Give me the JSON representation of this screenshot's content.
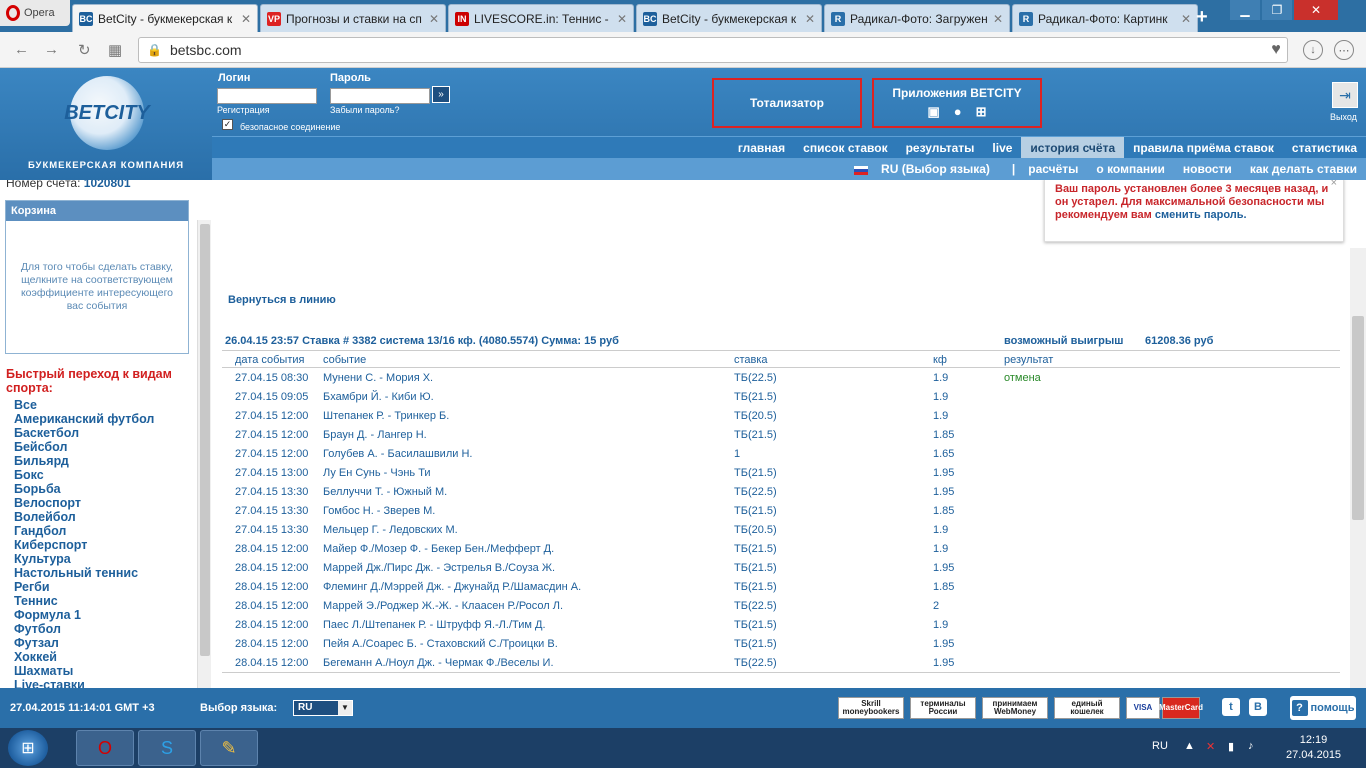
{
  "browser": {
    "menu_label": "Opera",
    "tabs": [
      {
        "title": "BetCity - букмекерская к",
        "icon": "BC",
        "color": "#1d5f9b"
      },
      {
        "title": "Прогнозы и ставки на сп",
        "icon": "VP",
        "color": "#d22"
      },
      {
        "title": "LIVESCORE.in: Теннис - А",
        "icon": "IN",
        "color": "#c00"
      },
      {
        "title": "BetCity - букмекерская к",
        "icon": "BC",
        "color": "#1d5f9b"
      },
      {
        "title": "Радикал-Фото: Загружен",
        "icon": "R",
        "color": "#2a6fa9"
      },
      {
        "title": "Радикал-Фото: Картинк",
        "icon": "R",
        "color": "#2a6fa9"
      }
    ],
    "url": "betsbc.com"
  },
  "header": {
    "logo_text": "BETCITY",
    "logo_sub": "БУКМЕКЕРСКАЯ КОМПАНИЯ",
    "login_label": "Логин",
    "password_label": "Пароль",
    "register_link": "Регистрация",
    "forgot_link": "Забыли пароль?",
    "secure_label": "безопасное соединение",
    "totalizator": "Тотализатор",
    "apps": "Приложения BETCITY",
    "exit": "Выход"
  },
  "menu_main": [
    "главная",
    "список ставок",
    "результаты",
    "live",
    "история счёта",
    "правила приёма ставок",
    "статистика"
  ],
  "menu_sub": {
    "lang": "RU (Выбор языка)",
    "items": [
      "расчёты",
      "о компании",
      "новости",
      "как делать ставки"
    ]
  },
  "left": {
    "account_label": "Номер счёта:",
    "account_number": "1020801",
    "basket_title": "Корзина",
    "basket_text": "Для того чтобы сделать ставку, щелкните на соответствующем коэффициенте интересующего вас события",
    "quick_title": "Быстрый переход к видам спорта:",
    "sports": [
      "Все",
      "Американский футбол",
      "Баскетбол",
      "Бейсбол",
      "Бильярд",
      "Бокс",
      "Борьба",
      "Велоспорт",
      "Волейбол",
      "Гандбол",
      "Киберспорт",
      "Культура",
      "Настольный теннис",
      "Регби",
      "Теннис",
      "Формула 1",
      "Футбол",
      "Футзал",
      "Хоккей",
      "Шахматы",
      "Live-ставки"
    ]
  },
  "notice": {
    "text": "Ваш пароль установлен более 3 месяцев назад, и он устарел. Для максимальной безопасности мы рекомендуем вам",
    "link": "сменить пароль.",
    "close": "×"
  },
  "bet": {
    "back_link": "Вернуться в линию",
    "summary": "26.04.15 23:57  Ставка # 3382  система 13/16 кф. (4080.5574)  Сумма: 15 руб",
    "win_label": "возможный выигрыш",
    "win_value": "61208.36 руб",
    "columns": [
      "дата события",
      "событие",
      "ставка",
      "кф",
      "результат"
    ],
    "rows": [
      [
        "27.04.15 08:30",
        "Мунени С. - Мория Х.",
        "ТБ(22.5)",
        "1.9",
        "отмена"
      ],
      [
        "27.04.15 09:05",
        "Бхамбри Й. - Киби Ю.",
        "ТБ(21.5)",
        "1.9",
        ""
      ],
      [
        "27.04.15 12:00",
        "Штепанек Р. - Тринкер Б.",
        "ТБ(20.5)",
        "1.9",
        ""
      ],
      [
        "27.04.15 12:00",
        "Браун Д. - Лангер Н.",
        "ТБ(21.5)",
        "1.85",
        ""
      ],
      [
        "27.04.15 12:00",
        "Голубев А. - Басилашвили Н.",
        "1",
        "1.65",
        ""
      ],
      [
        "27.04.15 13:00",
        "Лу Ен Сунь - Чэнь Ти",
        "ТБ(21.5)",
        "1.95",
        ""
      ],
      [
        "27.04.15 13:30",
        "Беллуччи Т. - Южный М.",
        "ТБ(22.5)",
        "1.95",
        ""
      ],
      [
        "27.04.15 13:30",
        "Гомбос Н. - Зверев М.",
        "ТБ(21.5)",
        "1.85",
        ""
      ],
      [
        "27.04.15 13:30",
        "Мельцер Г. - Ледовских М.",
        "ТБ(20.5)",
        "1.9",
        ""
      ],
      [
        "28.04.15 12:00",
        "Майер Ф./Мозер Ф. - Бекер Бен./Мефферт Д.",
        "ТБ(21.5)",
        "1.9",
        ""
      ],
      [
        "28.04.15 12:00",
        "Маррей Дж./Пирс Дж. - Эстрелья В./Соуза Ж.",
        "ТБ(21.5)",
        "1.95",
        ""
      ],
      [
        "28.04.15 12:00",
        "Флеминг Д./Мэррей Дж. - Джунайд Р./Шамасдин А.",
        "ТБ(21.5)",
        "1.85",
        ""
      ],
      [
        "28.04.15 12:00",
        "Маррей Э./Роджер Ж.-Ж. - Клаасен Р./Росол Л.",
        "ТБ(22.5)",
        "2",
        ""
      ],
      [
        "28.04.15 12:00",
        "Паес Л./Штепанек Р. - Штруфф Я.-Л./Тим Д.",
        "ТБ(21.5)",
        "1.9",
        ""
      ],
      [
        "28.04.15 12:00",
        "Пейя А./Соарес Б. - Стаховский С./Троицки В.",
        "ТБ(21.5)",
        "1.95",
        ""
      ],
      [
        "28.04.15 12:00",
        "Бегеманн А./Ноул Дж. - Чермак Ф./Веселы И.",
        "ТБ(22.5)",
        "1.95",
        ""
      ]
    ]
  },
  "footer": {
    "datetime": "27.04.2015  11:14:01  GMT +3",
    "lang_label": "Выбор языка:",
    "lang_value": "RU",
    "payments": [
      "Skrill moneybookers",
      "терминалы России",
      "принимаем WebMoney",
      "единый кошелек",
      "VISA",
      "MasterCard"
    ],
    "help": "помощь"
  },
  "taskbar": {
    "lang": "RU",
    "time": "12:19",
    "date": "27.04.2015"
  }
}
